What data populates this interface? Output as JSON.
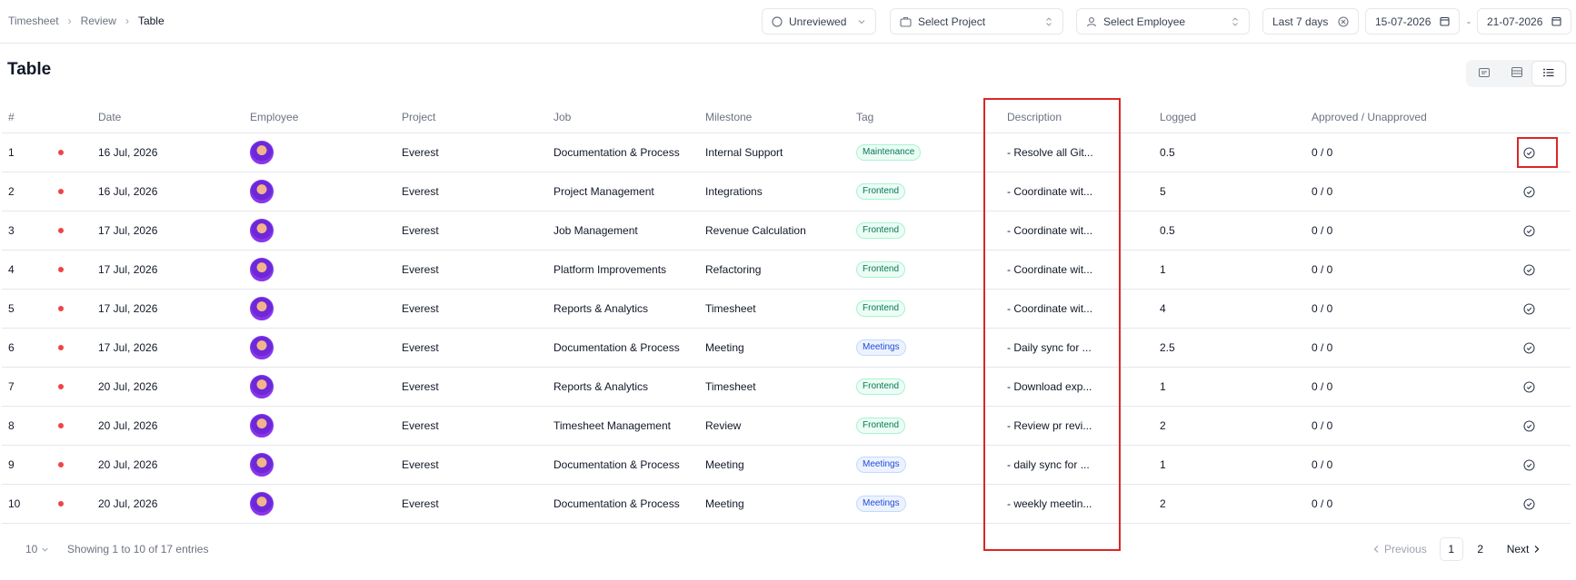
{
  "breadcrumb": {
    "items": [
      "Timesheet",
      "Review"
    ],
    "current": "Table"
  },
  "filters": {
    "status": "Unreviewed",
    "project_placeholder": "Select Project",
    "employee_placeholder": "Select Employee",
    "range": "Last 7 days",
    "date_from": "15-07-2026",
    "date_sep": "-",
    "date_to": "21-07-2026"
  },
  "page": {
    "title": "Table"
  },
  "view_modes": [
    "card-view-icon",
    "table-view-icon",
    "list-view-icon"
  ],
  "table": {
    "headers": {
      "num": "#",
      "date": "Date",
      "employee": "Employee",
      "project": "Project",
      "job": "Job",
      "milestone": "Milestone",
      "tag": "Tag",
      "description": "Description",
      "logged": "Logged",
      "approved": "Approved / Unapproved"
    },
    "rows": [
      {
        "num": "1",
        "date": "16 Jul, 2026",
        "project": "Everest",
        "job": "Documentation & Process",
        "milestone": "Internal Support",
        "tag": "Maintenance",
        "tag_color": "green",
        "description": "- Resolve all Git...",
        "logged": "0.5",
        "approved": "0 / 0"
      },
      {
        "num": "2",
        "date": "16 Jul, 2026",
        "project": "Everest",
        "job": "Project Management",
        "milestone": "Integrations",
        "tag": "Frontend",
        "tag_color": "green",
        "description": "- Coordinate wit...",
        "logged": "5",
        "approved": "0 / 0"
      },
      {
        "num": "3",
        "date": "17 Jul, 2026",
        "project": "Everest",
        "job": "Job Management",
        "milestone": "Revenue Calculation",
        "tag": "Frontend",
        "tag_color": "green",
        "description": "- Coordinate wit...",
        "logged": "0.5",
        "approved": "0 / 0"
      },
      {
        "num": "4",
        "date": "17 Jul, 2026",
        "project": "Everest",
        "job": "Platform Improvements",
        "milestone": "Refactoring",
        "tag": "Frontend",
        "tag_color": "green",
        "description": "- Coordinate wit...",
        "logged": "1",
        "approved": "0 / 0"
      },
      {
        "num": "5",
        "date": "17 Jul, 2026",
        "project": "Everest",
        "job": "Reports & Analytics",
        "milestone": "Timesheet",
        "tag": "Frontend",
        "tag_color": "green",
        "description": "- Coordinate wit...",
        "logged": "4",
        "approved": "0 / 0"
      },
      {
        "num": "6",
        "date": "17 Jul, 2026",
        "project": "Everest",
        "job": "Documentation & Process",
        "milestone": "Meeting",
        "tag": "Meetings",
        "tag_color": "blue",
        "description": "- Daily sync for ...",
        "logged": "2.5",
        "approved": "0 / 0"
      },
      {
        "num": "7",
        "date": "20 Jul, 2026",
        "project": "Everest",
        "job": "Reports & Analytics",
        "milestone": "Timesheet",
        "tag": "Frontend",
        "tag_color": "green",
        "description": "- Download exp...",
        "logged": "1",
        "approved": "0 / 0"
      },
      {
        "num": "8",
        "date": "20 Jul, 2026",
        "project": "Everest",
        "job": "Timesheet Management",
        "milestone": "Review",
        "tag": "Frontend",
        "tag_color": "green",
        "description": "- Review pr revi...",
        "logged": "2",
        "approved": "0 / 0"
      },
      {
        "num": "9",
        "date": "20 Jul, 2026",
        "project": "Everest",
        "job": "Documentation & Process",
        "milestone": "Meeting",
        "tag": "Meetings",
        "tag_color": "blue",
        "description": "- daily sync for ...",
        "logged": "1",
        "approved": "0 / 0"
      },
      {
        "num": "10",
        "date": "20 Jul, 2026",
        "project": "Everest",
        "job": "Documentation & Process",
        "milestone": "Meeting",
        "tag": "Meetings",
        "tag_color": "blue",
        "description": "- weekly meetin...",
        "logged": "2",
        "approved": "0 / 0"
      }
    ]
  },
  "footer": {
    "page_size": "10",
    "info": "Showing 1 to 10 of 17 entries",
    "prev": "Previous",
    "pages": [
      "1",
      "2"
    ],
    "current_page": "1",
    "next": "Next"
  },
  "colors": {
    "status_dot": "#ef4444",
    "highlight": "#dc2626",
    "tag_green": "#047857",
    "tag_blue": "#1d4ed8"
  }
}
